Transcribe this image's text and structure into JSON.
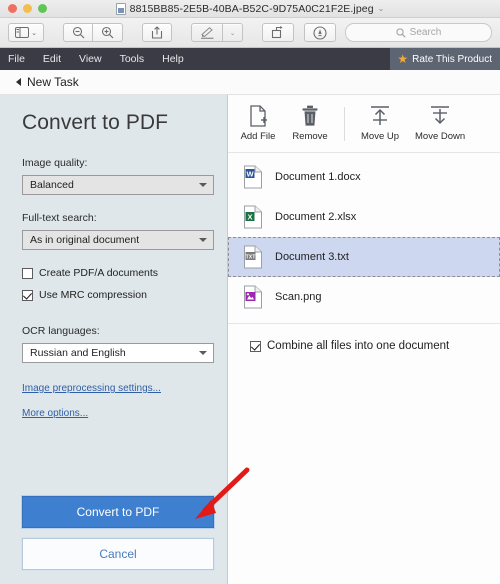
{
  "window": {
    "title": "8815BB85-2E5B-40BA-B52C-9D75A0C21F2E.jpeg",
    "title_chevron": "⌄",
    "traffic_lights": [
      "close",
      "minimize",
      "maximize"
    ]
  },
  "os_toolbar": {
    "sidebar_icon": "sidebar-toggle-icon",
    "sidebar_chevron": "⌄",
    "zoom_out_icon": "zoom-out-icon",
    "zoom_in_icon": "zoom-in-icon",
    "share_icon": "share-icon",
    "markup_icon": "markup-pen-icon",
    "markup_chevron": "⌄",
    "rotate_icon": "rotate-icon",
    "annotate_icon": "annotate-icon",
    "search_placeholder": "Search"
  },
  "menubar": {
    "items": [
      "File",
      "Edit",
      "View",
      "Tools",
      "Help"
    ],
    "rate_label": "Rate This Product",
    "star_glyph": "★",
    "background": "#3b3b45",
    "badge_background": "#5d6472",
    "star_color": "#f2a93b"
  },
  "breadcrumb": {
    "back_label": "New Task"
  },
  "left_pane": {
    "title": "Convert to PDF",
    "image_quality": {
      "label": "Image quality:",
      "value": "Balanced"
    },
    "full_text_search": {
      "label": "Full-text search:",
      "value": "As in original document"
    },
    "checkboxes": [
      {
        "label": "Create PDF/A documents",
        "checked": false
      },
      {
        "label": "Use MRC compression",
        "checked": true
      }
    ],
    "ocr_languages": {
      "label": "OCR languages:",
      "value": "Russian and English"
    },
    "links": [
      "Image preprocessing settings...",
      "More options..."
    ],
    "primary_button": "Convert to PDF",
    "secondary_button": "Cancel",
    "background": "#dfe7ea",
    "primary_color": "#3f7fd0",
    "link_color": "#2f5fa8"
  },
  "right_pane": {
    "toolbar": [
      {
        "label": "Add File",
        "icon": "add-file-icon"
      },
      {
        "label": "Remove",
        "icon": "trash-icon"
      },
      {
        "label": "Move Up",
        "icon": "move-up-icon"
      },
      {
        "label": "Move Down",
        "icon": "move-down-icon"
      }
    ],
    "files": [
      {
        "name": "Document 1.docx",
        "icon": "word-file-icon",
        "badge": "W",
        "color": "#2a5699",
        "selected": false
      },
      {
        "name": "Document 2.xlsx",
        "icon": "excel-file-icon",
        "badge": "X",
        "color": "#1e7145",
        "selected": false
      },
      {
        "name": "Document 3.txt",
        "icon": "text-file-icon",
        "badge": "TXT",
        "color": "#7a7a7a",
        "selected": true
      },
      {
        "name": "Scan.png",
        "icon": "image-file-icon",
        "badge": "",
        "color": "#9c27b0",
        "selected": false
      }
    ],
    "combine": {
      "label": "Combine all files into one document",
      "checked": true
    },
    "selection_color": "#cdd7ef"
  },
  "annotation": {
    "arrow": "red-arrow-pointing-to-convert-button",
    "color": "#e01b18"
  }
}
